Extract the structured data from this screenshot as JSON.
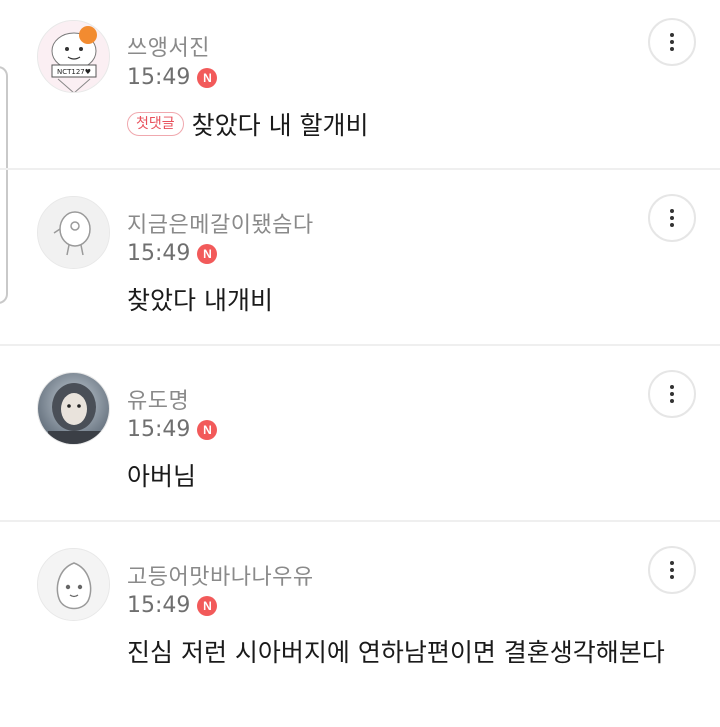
{
  "comments": [
    {
      "nickname": "쓰앵서진",
      "time": "15:49",
      "new_badge": "N",
      "first_comment_badge": "첫댓글",
      "text": "찾았다 내 할개비",
      "avatar_text": "NCT127♥",
      "avatar_icon": "cartoon-character-avatar"
    },
    {
      "nickname": "지금은메갈이됐슴다",
      "time": "15:49",
      "new_badge": "N",
      "text": "찾았다 내개비",
      "avatar_icon": "default-character-avatar"
    },
    {
      "nickname": "유도명",
      "time": "15:49",
      "new_badge": "N",
      "text": "아버님",
      "avatar_icon": "winter-hooded-man-photo-avatar"
    },
    {
      "nickname": "고등어맛바나나우유",
      "time": "15:49",
      "new_badge": "N",
      "text": "진심 저런 시아버지에 연하남편이면 결혼생각해본다",
      "avatar_icon": "peach-character-avatar"
    }
  ],
  "colors": {
    "new_badge": "#f25a5a",
    "first_badge_text": "#e8505b",
    "nickname": "#8a8a8a",
    "divider": "#efefef"
  }
}
